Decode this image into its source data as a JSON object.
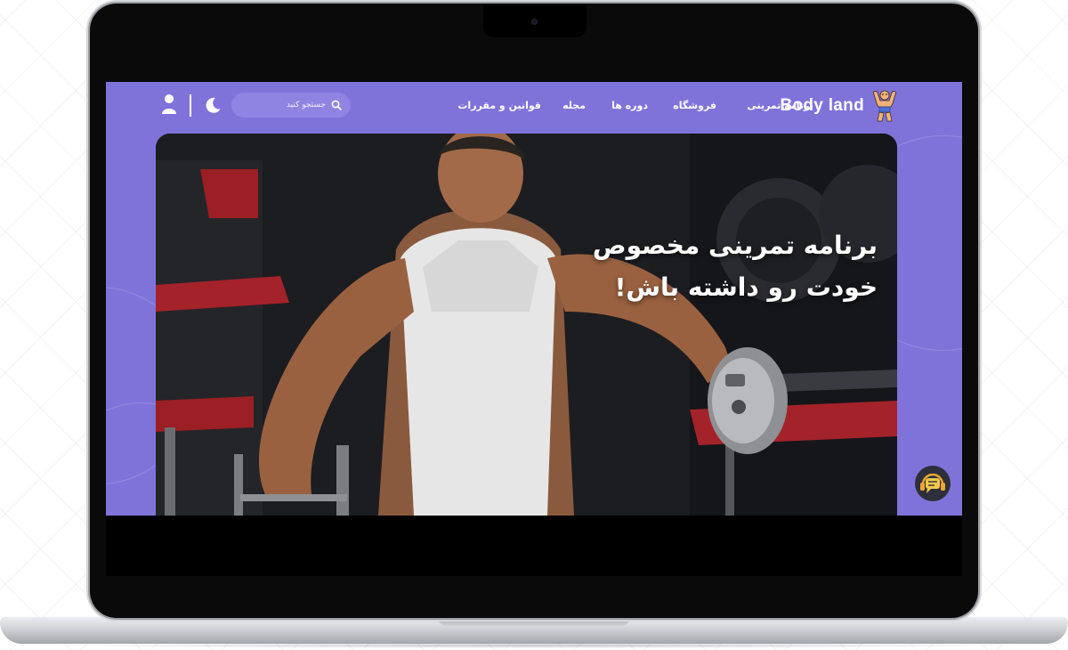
{
  "brand": {
    "name": "Body land",
    "accent_color": "#7f73da"
  },
  "nav": {
    "items": [
      {
        "label": "برنامه تمرینی"
      },
      {
        "label": "فروشگاه"
      },
      {
        "label": "دوره ها"
      },
      {
        "label": "مجله"
      },
      {
        "label": "قوانین و مقررات"
      }
    ]
  },
  "search": {
    "placeholder": "جستجو کنید",
    "icon": "search-icon"
  },
  "header_icons": {
    "theme_toggle": "moon-icon",
    "account": "user-icon"
  },
  "hero": {
    "title_line_1": "برنامه تمرینی مخصوص",
    "title_line_2": "خودت رو داشته باش!",
    "image": "man-lifting-dumbbells-photo"
  },
  "support": {
    "icon": "support-chat-icon"
  }
}
